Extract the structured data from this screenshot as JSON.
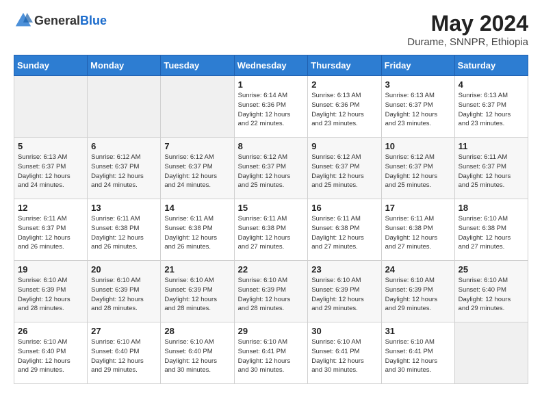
{
  "logo": {
    "general": "General",
    "blue": "Blue"
  },
  "title": {
    "month_year": "May 2024",
    "location": "Durame, SNNPR, Ethiopia"
  },
  "weekdays": [
    "Sunday",
    "Monday",
    "Tuesday",
    "Wednesday",
    "Thursday",
    "Friday",
    "Saturday"
  ],
  "weeks": [
    [
      {
        "day": "",
        "info": ""
      },
      {
        "day": "",
        "info": ""
      },
      {
        "day": "",
        "info": ""
      },
      {
        "day": "1",
        "info": "Sunrise: 6:14 AM\nSunset: 6:36 PM\nDaylight: 12 hours\nand 22 minutes."
      },
      {
        "day": "2",
        "info": "Sunrise: 6:13 AM\nSunset: 6:36 PM\nDaylight: 12 hours\nand 23 minutes."
      },
      {
        "day": "3",
        "info": "Sunrise: 6:13 AM\nSunset: 6:37 PM\nDaylight: 12 hours\nand 23 minutes."
      },
      {
        "day": "4",
        "info": "Sunrise: 6:13 AM\nSunset: 6:37 PM\nDaylight: 12 hours\nand 23 minutes."
      }
    ],
    [
      {
        "day": "5",
        "info": "Sunrise: 6:13 AM\nSunset: 6:37 PM\nDaylight: 12 hours\nand 24 minutes."
      },
      {
        "day": "6",
        "info": "Sunrise: 6:12 AM\nSunset: 6:37 PM\nDaylight: 12 hours\nand 24 minutes."
      },
      {
        "day": "7",
        "info": "Sunrise: 6:12 AM\nSunset: 6:37 PM\nDaylight: 12 hours\nand 24 minutes."
      },
      {
        "day": "8",
        "info": "Sunrise: 6:12 AM\nSunset: 6:37 PM\nDaylight: 12 hours\nand 25 minutes."
      },
      {
        "day": "9",
        "info": "Sunrise: 6:12 AM\nSunset: 6:37 PM\nDaylight: 12 hours\nand 25 minutes."
      },
      {
        "day": "10",
        "info": "Sunrise: 6:12 AM\nSunset: 6:37 PM\nDaylight: 12 hours\nand 25 minutes."
      },
      {
        "day": "11",
        "info": "Sunrise: 6:11 AM\nSunset: 6:37 PM\nDaylight: 12 hours\nand 25 minutes."
      }
    ],
    [
      {
        "day": "12",
        "info": "Sunrise: 6:11 AM\nSunset: 6:37 PM\nDaylight: 12 hours\nand 26 minutes."
      },
      {
        "day": "13",
        "info": "Sunrise: 6:11 AM\nSunset: 6:38 PM\nDaylight: 12 hours\nand 26 minutes."
      },
      {
        "day": "14",
        "info": "Sunrise: 6:11 AM\nSunset: 6:38 PM\nDaylight: 12 hours\nand 26 minutes."
      },
      {
        "day": "15",
        "info": "Sunrise: 6:11 AM\nSunset: 6:38 PM\nDaylight: 12 hours\nand 27 minutes."
      },
      {
        "day": "16",
        "info": "Sunrise: 6:11 AM\nSunset: 6:38 PM\nDaylight: 12 hours\nand 27 minutes."
      },
      {
        "day": "17",
        "info": "Sunrise: 6:11 AM\nSunset: 6:38 PM\nDaylight: 12 hours\nand 27 minutes."
      },
      {
        "day": "18",
        "info": "Sunrise: 6:10 AM\nSunset: 6:38 PM\nDaylight: 12 hours\nand 27 minutes."
      }
    ],
    [
      {
        "day": "19",
        "info": "Sunrise: 6:10 AM\nSunset: 6:39 PM\nDaylight: 12 hours\nand 28 minutes."
      },
      {
        "day": "20",
        "info": "Sunrise: 6:10 AM\nSunset: 6:39 PM\nDaylight: 12 hours\nand 28 minutes."
      },
      {
        "day": "21",
        "info": "Sunrise: 6:10 AM\nSunset: 6:39 PM\nDaylight: 12 hours\nand 28 minutes."
      },
      {
        "day": "22",
        "info": "Sunrise: 6:10 AM\nSunset: 6:39 PM\nDaylight: 12 hours\nand 28 minutes."
      },
      {
        "day": "23",
        "info": "Sunrise: 6:10 AM\nSunset: 6:39 PM\nDaylight: 12 hours\nand 29 minutes."
      },
      {
        "day": "24",
        "info": "Sunrise: 6:10 AM\nSunset: 6:39 PM\nDaylight: 12 hours\nand 29 minutes."
      },
      {
        "day": "25",
        "info": "Sunrise: 6:10 AM\nSunset: 6:40 PM\nDaylight: 12 hours\nand 29 minutes."
      }
    ],
    [
      {
        "day": "26",
        "info": "Sunrise: 6:10 AM\nSunset: 6:40 PM\nDaylight: 12 hours\nand 29 minutes."
      },
      {
        "day": "27",
        "info": "Sunrise: 6:10 AM\nSunset: 6:40 PM\nDaylight: 12 hours\nand 29 minutes."
      },
      {
        "day": "28",
        "info": "Sunrise: 6:10 AM\nSunset: 6:40 PM\nDaylight: 12 hours\nand 30 minutes."
      },
      {
        "day": "29",
        "info": "Sunrise: 6:10 AM\nSunset: 6:41 PM\nDaylight: 12 hours\nand 30 minutes."
      },
      {
        "day": "30",
        "info": "Sunrise: 6:10 AM\nSunset: 6:41 PM\nDaylight: 12 hours\nand 30 minutes."
      },
      {
        "day": "31",
        "info": "Sunrise: 6:10 AM\nSunset: 6:41 PM\nDaylight: 12 hours\nand 30 minutes."
      },
      {
        "day": "",
        "info": ""
      }
    ]
  ]
}
